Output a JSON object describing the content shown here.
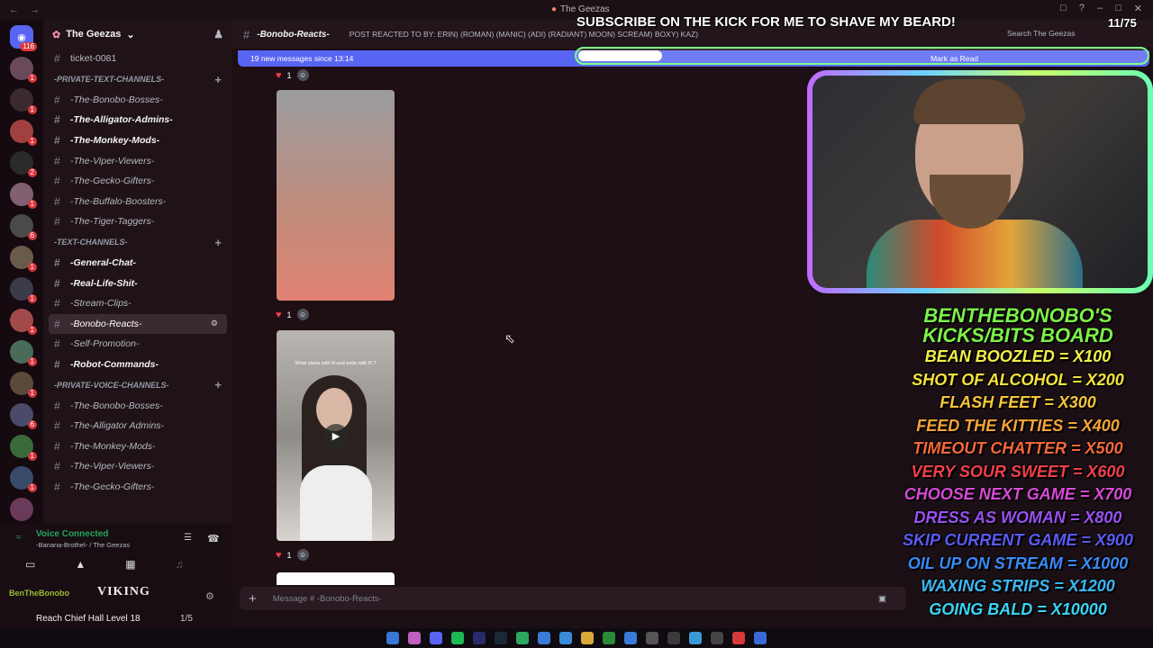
{
  "window": {
    "title": "The Geezas"
  },
  "overlay": {
    "banner": "SUBSCRIBE ON THE KICK FOR ME TO SHAVE MY BEARD!",
    "counter": "11/75",
    "goal_fraction": 0.147
  },
  "guilds": {
    "home_badge": "116",
    "badges": [
      "1",
      "1",
      "1",
      "2",
      "1",
      "6",
      "1",
      "1",
      "1",
      "1",
      "1",
      "6",
      "1",
      "1"
    ]
  },
  "server": {
    "name": "The Geezas"
  },
  "channels": [
    {
      "kind": "channel",
      "label": "ticket-0081",
      "style": "plain"
    },
    {
      "kind": "category",
      "label": "-PRIVATE-TEXT-CHANNELS-"
    },
    {
      "kind": "channel",
      "label": "-The-Bonobo-Bosses-",
      "style": "italic"
    },
    {
      "kind": "channel",
      "label": "-The-Alligator-Admins-",
      "style": "bold"
    },
    {
      "kind": "channel",
      "label": "-The-Monkey-Mods-",
      "style": "bold"
    },
    {
      "kind": "channel",
      "label": "-The-Viper-Viewers-",
      "style": "italic"
    },
    {
      "kind": "channel",
      "label": "-The-Gecko-Gifters-",
      "style": "italic"
    },
    {
      "kind": "channel",
      "label": "-The-Buffalo-Boosters-",
      "style": "italic"
    },
    {
      "kind": "channel",
      "label": "-The-Tiger-Taggers-",
      "style": "italic"
    },
    {
      "kind": "category",
      "label": "-TEXT-CHANNELS-"
    },
    {
      "kind": "channel",
      "label": "-General-Chat-",
      "style": "bold"
    },
    {
      "kind": "channel",
      "label": "-Real-Life-Shit-",
      "style": "bold"
    },
    {
      "kind": "channel",
      "label": "-Stream-Clips-",
      "style": "italic"
    },
    {
      "kind": "channel",
      "label": "-Bonobo-Reacts-",
      "style": "active"
    },
    {
      "kind": "channel",
      "label": "-Self-Promotion-",
      "style": "italic"
    },
    {
      "kind": "channel",
      "label": "-Robot-Commands-",
      "style": "bold"
    },
    {
      "kind": "category",
      "label": "-PRIVATE-VOICE-CHANNELS-"
    },
    {
      "kind": "channel",
      "label": "-The-Bonobo-Bosses-",
      "style": "italic"
    },
    {
      "kind": "channel",
      "label": "-The-Alligator Admins-",
      "style": "italic"
    },
    {
      "kind": "channel",
      "label": "-The-Monkey-Mods-",
      "style": "italic"
    },
    {
      "kind": "channel",
      "label": "-The-Viper-Viewers-",
      "style": "italic"
    },
    {
      "kind": "channel",
      "label": "-The-Gecko-Gifters-",
      "style": "italic"
    }
  ],
  "voice": {
    "status": "Voice Connected",
    "channel": "-Banana-Brothel- / The Geezas",
    "user": "BenTheBonobo",
    "logo": "VIKING",
    "quest": "Reach Chief Hall Level 18",
    "quest_count": "1/5"
  },
  "chat": {
    "channel_name": "-Bonobo-Reacts-",
    "topic": "POST REACTED TO BY: ERIN) (ROMAN) (MANIC) (ADI) (RADIANT) MOON) SCREAM) BOXY) KAZ)",
    "search_placeholder": "Search The Geezas",
    "new_messages": "19 new messages since 13:14",
    "mark_read": "Mark as Read",
    "reactions": [
      {
        "emoji": "♥",
        "count": "1"
      },
      {
        "emoji": "♥",
        "count": "1"
      },
      {
        "emoji": "♥",
        "count": "1"
      }
    ],
    "video_caption": "What starts with N and ends with R ?",
    "composer_placeholder": "Message # -Bonobo-Reacts-"
  },
  "board": {
    "title": "BENTHEBONOBO'S KICKS/BITS BOARD",
    "items": [
      {
        "text": "BEAN BOOZLED = X100",
        "color": "#f3f04a"
      },
      {
        "text": "SHOT OF ALCOHOL = X200",
        "color": "#f6e23a"
      },
      {
        "text": "FLASH FEET = X300",
        "color": "#f8c43a"
      },
      {
        "text": "FEED THE KITTIES = X400",
        "color": "#f8a43a"
      },
      {
        "text": "TIMEOUT CHATTER = X500",
        "color": "#f5683a"
      },
      {
        "text": "VERY SOUR SWEET = X600",
        "color": "#f0404a"
      },
      {
        "text": "CHOOSE NEXT GAME = X700",
        "color": "#d84ad8"
      },
      {
        "text": "DRESS AS WOMAN = X800",
        "color": "#9a50f0"
      },
      {
        "text": "SKIP CURRENT GAME = X900",
        "color": "#5a5af4"
      },
      {
        "text": "OIL UP ON STREAM = X1000",
        "color": "#3a8af4"
      },
      {
        "text": "WAXING STRIPS = X1200",
        "color": "#3ab8f4"
      },
      {
        "text": "GOING BALD = X10000",
        "color": "#3ad4f4"
      }
    ]
  },
  "taskbar": {
    "app_colors": [
      "#3a78d8",
      "#c060c0",
      "#5865f2",
      "#1db954",
      "#2a2a6a",
      "#1b2838",
      "#2aa860",
      "#3a7ad8",
      "#3a8ad8",
      "#d8a838",
      "#2a8a3a",
      "#3a7ad8",
      "#555555",
      "#3a3a3a",
      "#3a9ad8",
      "#444444",
      "#d83a3a",
      "#3a6ad8"
    ]
  }
}
